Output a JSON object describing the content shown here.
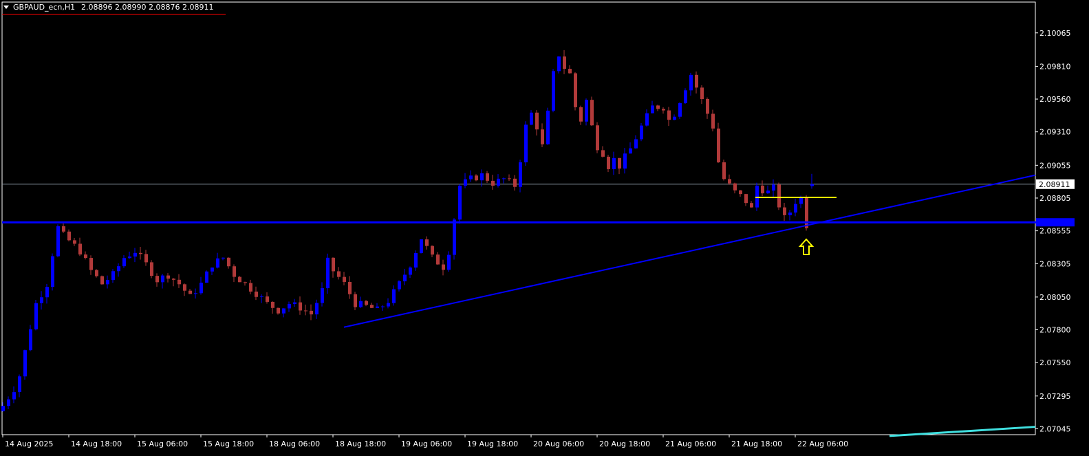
{
  "header": {
    "symbol": "GBPAUD_ecn,H1",
    "ohlc": "2.08896 2.08990 2.08876 2.08911"
  },
  "price_tag": "2.08911",
  "colors": {
    "background": "#000000",
    "bull": "#0000ff",
    "bear": "#b23a3a",
    "axis": "#ffffff",
    "price_line": "#8c99a6",
    "support": "#0000ff",
    "trendline": "#0000ff",
    "resistance": "#ffff00",
    "arrow": "#ffff00",
    "cyan_line": "#40e0e0",
    "header_underline": "#ff0000"
  },
  "chart_data": {
    "type": "candlestick",
    "title": "GBPAUD_ecn,H1",
    "timeframe": "H1",
    "last_ohlc": {
      "open": 2.08896,
      "high": 2.0899,
      "low": 2.08876,
      "close": 2.08911
    },
    "y_ticks": [
      2.10065,
      2.0981,
      2.0956,
      2.0931,
      2.09055,
      2.08805,
      2.08555,
      2.08305,
      2.0805,
      2.078,
      2.0755,
      2.07295,
      2.07045
    ],
    "ylim": [
      2.07,
      2.103
    ],
    "x_ticks": [
      {
        "bar": 0,
        "label": "14 Aug 2025"
      },
      {
        "bar": 12,
        "label": "14 Aug 18:00"
      },
      {
        "bar": 24,
        "label": "15 Aug 06:00"
      },
      {
        "bar": 36,
        "label": "15 Aug 18:00"
      },
      {
        "bar": 48,
        "label": "18 Aug 06:00"
      },
      {
        "bar": 60,
        "label": "18 Aug 18:00"
      },
      {
        "bar": 72,
        "label": "19 Aug 06:00"
      },
      {
        "bar": 84,
        "label": "19 Aug 18:00"
      },
      {
        "bar": 96,
        "label": "20 Aug 06:00"
      },
      {
        "bar": 108,
        "label": "20 Aug 18:00"
      },
      {
        "bar": 120,
        "label": "21 Aug 06:00"
      },
      {
        "bar": 132,
        "label": "21 Aug 18:00"
      },
      {
        "bar": 144,
        "label": "22 Aug 06:00"
      }
    ],
    "close_path": [
      [
        0,
        2.0722
      ],
      [
        2,
        2.0735
      ],
      [
        3,
        2.0745
      ],
      [
        5,
        2.0782
      ],
      [
        6,
        2.08
      ],
      [
        8,
        2.0815
      ],
      [
        9,
        2.0838
      ],
      [
        10,
        2.0858
      ],
      [
        11,
        2.0852
      ],
      [
        12,
        2.0848
      ],
      [
        14,
        2.084
      ],
      [
        16,
        2.0825
      ],
      [
        18,
        2.0815
      ],
      [
        20,
        2.0822
      ],
      [
        22,
        2.0835
      ],
      [
        24,
        2.084
      ],
      [
        26,
        2.083
      ],
      [
        28,
        2.0818
      ],
      [
        30,
        2.0822
      ],
      [
        32,
        2.0815
      ],
      [
        34,
        2.0805
      ],
      [
        36,
        2.0815
      ],
      [
        38,
        2.083
      ],
      [
        40,
        2.0835
      ],
      [
        42,
        2.0822
      ],
      [
        44,
        2.0815
      ],
      [
        46,
        2.0808
      ],
      [
        48,
        2.08
      ],
      [
        50,
        2.0795
      ],
      [
        52,
        2.08
      ],
      [
        54,
        2.0797
      ],
      [
        56,
        2.0792
      ],
      [
        58,
        2.081
      ],
      [
        59,
        2.0832
      ],
      [
        60,
        2.0825
      ],
      [
        62,
        2.0815
      ],
      [
        64,
        2.08
      ],
      [
        66,
        2.0798
      ],
      [
        68,
        2.0795
      ],
      [
        70,
        2.0802
      ],
      [
        72,
        2.0815
      ],
      [
        74,
        2.083
      ],
      [
        76,
        2.085
      ],
      [
        78,
        2.0835
      ],
      [
        80,
        2.0828
      ],
      [
        81,
        2.084
      ],
      [
        82,
        2.0865
      ],
      [
        83,
        2.089
      ],
      [
        85,
        2.0895
      ],
      [
        87,
        2.0898
      ],
      [
        89,
        2.0892
      ],
      [
        91,
        2.0895
      ],
      [
        93,
        2.089
      ],
      [
        94,
        2.091
      ],
      [
        95,
        2.0935
      ],
      [
        96,
        2.0945
      ],
      [
        97,
        2.0935
      ],
      [
        98,
        2.092
      ],
      [
        99,
        2.0945
      ],
      [
        100,
        2.0975
      ],
      [
        101,
        2.099
      ],
      [
        102,
        2.098
      ],
      [
        103,
        2.0975
      ],
      [
        104,
        2.095
      ],
      [
        105,
        2.094
      ],
      [
        106,
        2.0955
      ],
      [
        107,
        2.0935
      ],
      [
        108,
        2.092
      ],
      [
        109,
        2.0915
      ],
      [
        110,
        2.0905
      ],
      [
        111,
        2.091
      ],
      [
        112,
        2.0905
      ],
      [
        114,
        2.0918
      ],
      [
        116,
        2.0935
      ],
      [
        118,
        2.095
      ],
      [
        120,
        2.095
      ],
      [
        121,
        2.094
      ],
      [
        122,
        2.0945
      ],
      [
        123,
        2.0955
      ],
      [
        124,
        2.0965
      ],
      [
        125,
        2.0975
      ],
      [
        126,
        2.0965
      ],
      [
        127,
        2.0955
      ],
      [
        128,
        2.0945
      ],
      [
        129,
        2.0935
      ],
      [
        130,
        2.0908
      ],
      [
        131,
        2.0895
      ],
      [
        132,
        2.089
      ],
      [
        133,
        2.0885
      ],
      [
        134,
        2.0882
      ],
      [
        135,
        2.0878
      ],
      [
        136,
        2.0872
      ],
      [
        137,
        2.089
      ],
      [
        138,
        2.0887
      ],
      [
        139,
        2.0885
      ],
      [
        140,
        2.0888
      ],
      [
        141,
        2.0875
      ],
      [
        142,
        2.0865
      ],
      [
        143,
        2.087
      ],
      [
        144,
        2.0878
      ],
      [
        145,
        2.088
      ],
      [
        146,
        2.086
      ],
      [
        147,
        2.0891
      ]
    ],
    "drawn_lines": {
      "support": {
        "price": 2.0862
      },
      "resistance_segment": {
        "price": 2.0881,
        "from_bar": 136,
        "to_bar": 146
      },
      "trendline": {
        "from": [
          62,
          2.0782
        ],
        "to": [
          167,
          2.0898
        ]
      },
      "cyan_line": {
        "from": [
          150,
          2.0699
        ],
        "to": [
          167,
          2.0706
        ]
      },
      "up_arrow": {
        "bar": 146,
        "price": 2.0849
      }
    }
  }
}
